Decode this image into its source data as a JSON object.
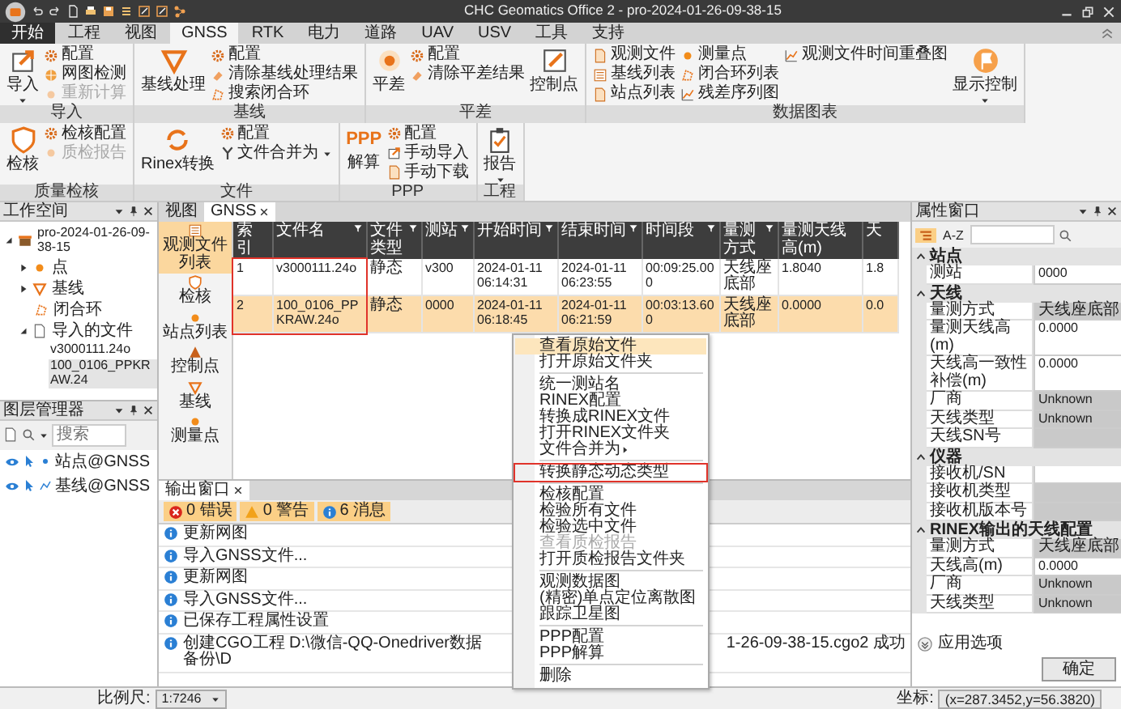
{
  "window": {
    "title": "CHC Geomatics Office 2 - pro-2024-01-26-09-38-15"
  },
  "menu_tabs": [
    {
      "label": "开始",
      "kind": "app",
      "selected": false
    },
    {
      "label": "工程",
      "kind": "tab",
      "selected": false
    },
    {
      "label": "视图",
      "kind": "tab",
      "selected": false
    },
    {
      "label": "GNSS",
      "kind": "tab",
      "selected": true
    },
    {
      "label": "RTK",
      "kind": "tab",
      "selected": false
    },
    {
      "label": "电力",
      "kind": "tab",
      "selected": false
    },
    {
      "label": "道路",
      "kind": "tab",
      "selected": false
    },
    {
      "label": "UAV",
      "kind": "tab",
      "selected": false
    },
    {
      "label": "USV",
      "kind": "tab",
      "selected": false
    },
    {
      "label": "工具",
      "kind": "tab",
      "selected": false
    },
    {
      "label": "支持",
      "kind": "tab",
      "selected": false
    }
  ],
  "ribbon": [
    {
      "title": "导入",
      "items": [
        {
          "label": "导入",
          "kind": "large",
          "disabled": false,
          "dropdown": true
        },
        {
          "label": "配置",
          "kind": "small",
          "disabled": false
        },
        {
          "label": "网图检测",
          "kind": "small",
          "disabled": false
        },
        {
          "label": "重新计算",
          "kind": "small",
          "disabled": true
        }
      ]
    },
    {
      "title": "基线",
      "items": [
        {
          "label": "基线处理",
          "kind": "large",
          "disabled": false
        },
        {
          "label": "配置",
          "kind": "small",
          "disabled": false
        },
        {
          "label": "清除基线处理结果",
          "kind": "small",
          "disabled": false
        },
        {
          "label": "搜索闭合环",
          "kind": "small",
          "disabled": false
        }
      ]
    },
    {
      "title": "平差",
      "items": [
        {
          "label": "平差",
          "kind": "large",
          "disabled": false
        },
        {
          "label": "配置",
          "kind": "small",
          "disabled": false
        },
        {
          "label": "清除平差结果",
          "kind": "small",
          "disabled": false
        },
        {
          "label": "控制点",
          "kind": "large",
          "disabled": false
        }
      ]
    },
    {
      "title": "数据图表",
      "items": [
        {
          "label": "观测文件",
          "kind": "small",
          "disabled": false
        },
        {
          "label": "基线列表",
          "kind": "small",
          "disabled": false
        },
        {
          "label": "站点列表",
          "kind": "small",
          "disabled": false
        },
        {
          "label": "测量点",
          "kind": "small",
          "disabled": false
        },
        {
          "label": "闭合环列表",
          "kind": "small",
          "disabled": false
        },
        {
          "label": "残差序列图",
          "kind": "small",
          "disabled": false
        },
        {
          "label": "观测文件时间重叠图",
          "kind": "small",
          "disabled": false
        },
        {
          "label": "显示控制",
          "kind": "large",
          "disabled": false,
          "dropdown": true
        }
      ]
    },
    {
      "title": "质量检核",
      "items": [
        {
          "label": "检核",
          "kind": "large",
          "disabled": false
        },
        {
          "label": "检核配置",
          "kind": "small",
          "disabled": false
        },
        {
          "label": "质检报告",
          "kind": "small",
          "disabled": true
        }
      ]
    },
    {
      "title": "文件",
      "items": [
        {
          "label": "Rinex转换",
          "kind": "large",
          "disabled": false
        },
        {
          "label": "配置",
          "kind": "small",
          "disabled": false
        },
        {
          "label": "文件合并为",
          "kind": "small",
          "disabled": false,
          "dropdown": true
        }
      ]
    },
    {
      "title": "PPP",
      "items": [
        {
          "label": "解算",
          "kind": "large",
          "disabled": false,
          "glyph": "PPP"
        },
        {
          "label": "配置",
          "kind": "small",
          "disabled": false
        },
        {
          "label": "手动导入",
          "kind": "small",
          "disabled": false
        },
        {
          "label": "手动下载",
          "kind": "small",
          "disabled": false
        }
      ]
    },
    {
      "title": "工程",
      "items": [
        {
          "label": "报告",
          "kind": "large",
          "disabled": false,
          "dropdown": true
        }
      ]
    }
  ],
  "workspace": {
    "title": "工作空间",
    "tree": [
      {
        "label": "pro-2024-01-26-09-38-15",
        "kind": "project",
        "expanded": true,
        "selected": false,
        "children": [
          {
            "label": "点",
            "kind": "point",
            "expanded": false,
            "selected": false
          },
          {
            "label": "基线",
            "kind": "baseline",
            "expanded": false,
            "selected": false
          },
          {
            "label": "闭合环",
            "kind": "loop",
            "selected": false
          },
          {
            "label": "导入的文件",
            "kind": "folder",
            "expanded": true,
            "selected": false,
            "children": [
              {
                "label": "v3000111.24o",
                "selected": false
              },
              {
                "label": "100_0106_PPKRAW.24",
                "selected": true
              }
            ]
          }
        ]
      }
    ]
  },
  "layers": {
    "title": "图层管理器",
    "search_placeholder": "搜索",
    "items": [
      {
        "label": "站点@GNSS",
        "kind": "point",
        "visible": true
      },
      {
        "label": "基线@GNSS",
        "kind": "line",
        "visible": true
      }
    ]
  },
  "docs": {
    "tabs": [
      {
        "label": "视图",
        "selected": false,
        "closable": false
      },
      {
        "label": "GNSS",
        "selected": true,
        "closable": true
      }
    ],
    "nav": [
      {
        "label": "观测文件列表",
        "selected": true
      },
      {
        "label": "检核",
        "selected": false
      },
      {
        "label": "站点列表",
        "selected": false
      },
      {
        "label": "控制点",
        "selected": false
      },
      {
        "label": "基线",
        "selected": false
      },
      {
        "label": "测量点",
        "selected": false
      }
    ],
    "table": {
      "columns": [
        {
          "label": "索引",
          "filter": false,
          "highlighted": true
        },
        {
          "label": "文件名",
          "filter": true,
          "highlighted": true
        },
        {
          "label": "文件类型",
          "filter": true,
          "highlighted": false
        },
        {
          "label": "测站",
          "filter": true,
          "highlighted": false
        },
        {
          "label": "开始时间",
          "filter": true,
          "highlighted": false
        },
        {
          "label": "结束时间",
          "filter": true,
          "highlighted": false
        },
        {
          "label": "时间段",
          "filter": true,
          "highlighted": false
        },
        {
          "label": "量测方式",
          "filter": true,
          "highlighted": false
        },
        {
          "label": "量测天线高(m)",
          "filter": false,
          "highlighted": false
        },
        {
          "label": "天",
          "filter": false,
          "highlighted": false
        }
      ],
      "rows": [
        {
          "selected": false,
          "cells": [
            "1",
            "v3000111.24o",
            "静态",
            "v300",
            "2024-01-11 06:14:31",
            "2024-01-11 06:23:55",
            "00:09:25.000",
            "天线座底部",
            "1.8040",
            "1.8"
          ]
        },
        {
          "selected": true,
          "cells": [
            "2",
            "100_0106_PPKRAW.24o",
            "静态",
            "0000",
            "2024-01-11 06:18:45",
            "2024-01-11 06:21:59",
            "00:03:13.600",
            "天线座底部",
            "0.0000",
            "0.0"
          ]
        }
      ]
    }
  },
  "context_menu": [
    {
      "kind": "item",
      "label": "查看原始文件",
      "disabled": false,
      "hovered": true,
      "highlighted": false,
      "submenu": false
    },
    {
      "kind": "item",
      "label": "打开原始文件夹",
      "disabled": false,
      "hovered": false,
      "highlighted": false,
      "submenu": false
    },
    {
      "kind": "separator"
    },
    {
      "kind": "item",
      "label": "统一测站名",
      "disabled": false,
      "hovered": false,
      "highlighted": false,
      "submenu": false
    },
    {
      "kind": "item",
      "label": "RINEX配置",
      "disabled": false,
      "hovered": false,
      "highlighted": false,
      "submenu": false
    },
    {
      "kind": "item",
      "label": "转换成RINEX文件",
      "disabled": false,
      "hovered": false,
      "highlighted": false,
      "submenu": false
    },
    {
      "kind": "item",
      "label": "打开RINEX文件夹",
      "disabled": false,
      "hovered": false,
      "highlighted": false,
      "submenu": false
    },
    {
      "kind": "item",
      "label": "文件合并为",
      "disabled": false,
      "hovered": false,
      "highlighted": false,
      "submenu": true
    },
    {
      "kind": "separator"
    },
    {
      "kind": "item",
      "label": "转换静态动态类型",
      "disabled": false,
      "hovered": false,
      "highlighted": true,
      "submenu": false
    },
    {
      "kind": "separator"
    },
    {
      "kind": "item",
      "label": "检核配置",
      "disabled": false,
      "hovered": false,
      "highlighted": false,
      "submenu": false
    },
    {
      "kind": "item",
      "label": "检验所有文件",
      "disabled": false,
      "hovered": false,
      "highlighted": false,
      "submenu": false
    },
    {
      "kind": "item",
      "label": "检验选中文件",
      "disabled": false,
      "hovered": false,
      "highlighted": false,
      "submenu": false
    },
    {
      "kind": "item",
      "label": "查看质检报告",
      "disabled": true,
      "hovered": false,
      "highlighted": false,
      "submenu": false
    },
    {
      "kind": "item",
      "label": "打开质检报告文件夹",
      "disabled": false,
      "hovered": false,
      "highlighted": false,
      "submenu": false
    },
    {
      "kind": "separator"
    },
    {
      "kind": "item",
      "label": "观测数据图",
      "disabled": false,
      "hovered": false,
      "highlighted": false,
      "submenu": false
    },
    {
      "kind": "item",
      "label": "(精密)单点定位离散图",
      "disabled": false,
      "hovered": false,
      "highlighted": false,
      "submenu": false
    },
    {
      "kind": "item",
      "label": "跟踪卫星图",
      "disabled": false,
      "hovered": false,
      "highlighted": false,
      "submenu": false
    },
    {
      "kind": "separator"
    },
    {
      "kind": "item",
      "label": "PPP配置",
      "disabled": false,
      "hovered": false,
      "highlighted": false,
      "submenu": false
    },
    {
      "kind": "item",
      "label": "PPP解算",
      "disabled": false,
      "hovered": false,
      "highlighted": false,
      "submenu": false
    },
    {
      "kind": "separator"
    },
    {
      "kind": "item",
      "label": "删除",
      "disabled": false,
      "hovered": false,
      "highlighted": false,
      "submenu": false
    }
  ],
  "output": {
    "title": "输出窗口",
    "filters": [
      {
        "label": "0 错误",
        "kind": "error",
        "selected": true
      },
      {
        "label": "0 警告",
        "kind": "warning",
        "selected": true
      },
      {
        "label": "6 消息",
        "kind": "info",
        "selected": true
      }
    ],
    "messages": [
      {
        "text": "更新网图"
      },
      {
        "text": "导入GNSS文件..."
      },
      {
        "text": "更新网图"
      },
      {
        "text": "导入GNSS文件..."
      },
      {
        "text": "已保存工程属性设置"
      },
      {
        "text": "创建CGO工程 D:\\微信-QQ-Onedriver数据备份\\D",
        "text_after": "1-26-09-38-15.cgo2 成功"
      }
    ]
  },
  "properties": {
    "title": "属性窗口",
    "sort_buttons": [
      {
        "kind": "categorized",
        "selected": true
      },
      {
        "kind": "alphabetical",
        "label": "A-Z",
        "selected": false
      }
    ],
    "categories": [
      {
        "title": "站点",
        "expanded": true,
        "rows": [
          {
            "label": "测站",
            "value": "0000",
            "editable": true
          }
        ]
      },
      {
        "title": "天线",
        "expanded": true,
        "rows": [
          {
            "label": "量测方式",
            "value": "天线座底部",
            "editable": false
          },
          {
            "label": "量测天线高(m)",
            "value": "0.0000",
            "editable": true
          },
          {
            "label": "天线高一致性补偿(m)",
            "value": "0.0000",
            "editable": true
          },
          {
            "label": "厂商",
            "value": "Unknown",
            "editable": false
          },
          {
            "label": "天线类型",
            "value": "Unknown",
            "editable": false
          },
          {
            "label": "天线SN号",
            "editable": false
          }
        ]
      },
      {
        "title": "仪器",
        "expanded": true,
        "rows": [
          {
            "label": "接收机/SN",
            "editable": true
          },
          {
            "label": "接收机类型",
            "editable": false
          },
          {
            "label": "接收机版本号",
            "editable": false
          }
        ]
      },
      {
        "title": "RINEX输出的天线配置",
        "expanded": true,
        "rows": [
          {
            "label": "量测方式",
            "value": "天线座底部",
            "editable": false
          },
          {
            "label": "天线高(m)",
            "value": "0.0000",
            "editable": true
          },
          {
            "label": "厂商",
            "value": "Unknown",
            "editable": false
          },
          {
            "label": "天线类型",
            "value": "Unknown",
            "editable": false
          }
        ]
      }
    ],
    "options_label": "应用选项",
    "ok_button": "确定"
  },
  "status_bar": {
    "scale_label": "比例尺:",
    "scale_value": "1:7246",
    "coord_label": "坐标:",
    "coord_value": "(x=287.3452,y=56.3820)"
  }
}
